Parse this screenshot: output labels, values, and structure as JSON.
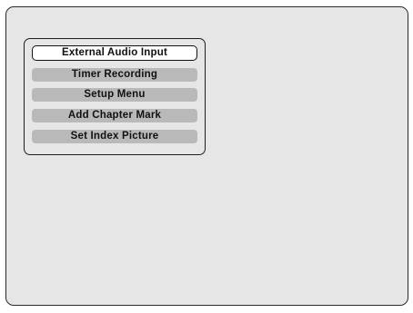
{
  "menu": {
    "selected_index": 0,
    "items": [
      {
        "label": "External Audio Input"
      },
      {
        "label": "Timer Recording"
      },
      {
        "label": "Setup Menu"
      },
      {
        "label": "Add Chapter Mark"
      },
      {
        "label": "Set Index Picture"
      }
    ]
  },
  "colors": {
    "screen_background": "#e6e6e6",
    "item_background": "#b9b9b9",
    "selected_item_background": "#ffffff",
    "border": "#1e1e1e"
  }
}
